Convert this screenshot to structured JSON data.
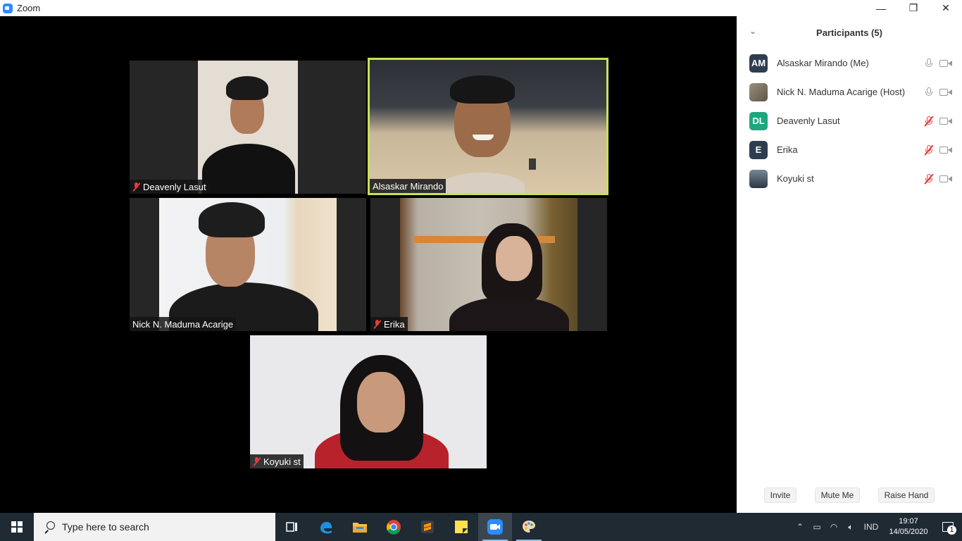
{
  "window": {
    "title": "Zoom",
    "minimize": "—",
    "restore": "❐",
    "close": "✕"
  },
  "tiles": [
    {
      "name": "Deavenly Lasut",
      "muted": true
    },
    {
      "name": "Alsaskar Mirando",
      "muted": false,
      "active": true
    },
    {
      "name": "Nick N. Maduma Acarige",
      "muted": false
    },
    {
      "name": "Erika",
      "muted": true
    },
    {
      "name": "Koyuki st",
      "muted": true
    }
  ],
  "participants": {
    "title": "Participants (5)",
    "items": [
      {
        "initials": "AM",
        "name": "Alsaskar Mirando (Me)",
        "avatar_color": "#2e3e50",
        "muted": false
      },
      {
        "initials": "",
        "name": "Nick N. Maduma Acarige (Host)",
        "avatar_color": "#7b7466",
        "muted": false
      },
      {
        "initials": "DL",
        "name": "Deavenly Lasut",
        "avatar_color": "#1ea67c",
        "muted": true
      },
      {
        "initials": "E",
        "name": "Erika",
        "avatar_color": "#2e3e50",
        "muted": true
      },
      {
        "initials": "",
        "name": "Koyuki st",
        "avatar_color": "#3c4a5a",
        "muted": true
      }
    ],
    "buttons": {
      "invite": "Invite",
      "mute_me": "Mute Me",
      "raise_hand": "Raise Hand"
    }
  },
  "taskbar": {
    "search_placeholder": "Type here to search",
    "language": "IND",
    "time": "19:07",
    "date": "14/05/2020",
    "notification_count": "1"
  },
  "colors": {
    "active_speaker_border": "#c8e25a",
    "muted_red": "#e23b3b",
    "zoom_blue": "#2D8CFF"
  }
}
